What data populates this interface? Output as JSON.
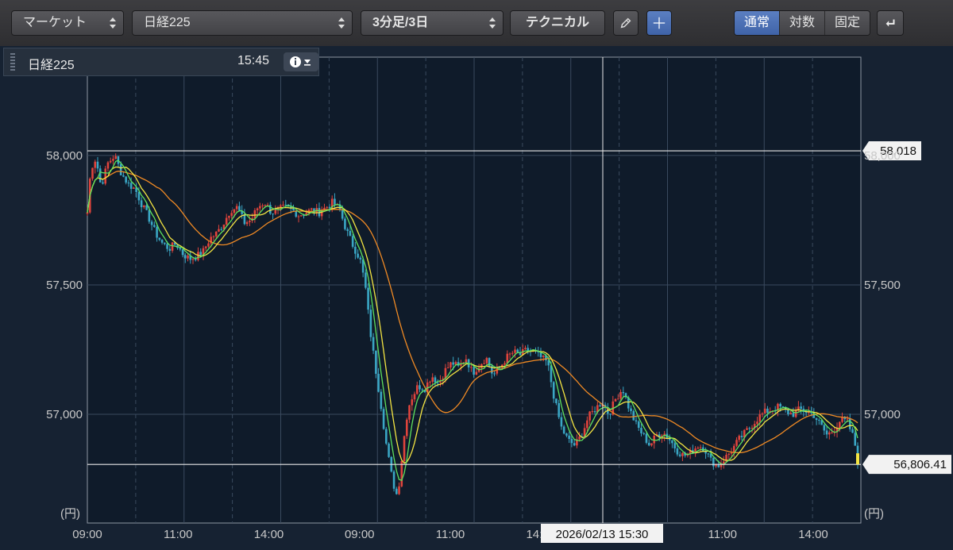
{
  "toolbar": {
    "market_label": "マーケット",
    "symbol_label": "日経225",
    "interval_label": "3分足/3日",
    "technical_label": "テクニカル",
    "scale_modes": [
      {
        "label": "通常",
        "active": true
      },
      {
        "label": "対数",
        "active": false
      },
      {
        "label": "固定",
        "active": false
      }
    ]
  },
  "legend": {
    "symbol": "日経225",
    "time": "15:45"
  },
  "cursor_label": "2026/02/13 15:30",
  "chart_data": {
    "type": "candlestick",
    "y_unit": "(円)",
    "ylim": [
      56580,
      58380
    ],
    "y_ticks": [
      57000,
      57500,
      58000
    ],
    "y_tick_labels": [
      "57,000",
      "57,500",
      "58,000"
    ],
    "x_tick_labels": [
      "09:00",
      "11:00",
      "14:00",
      "09:00",
      "11:00",
      "14:00",
      "09:00",
      "11:00",
      "14:00"
    ],
    "reference_lines": [
      {
        "value": 58018,
        "label": "58,018"
      },
      {
        "value": 56806.41,
        "label": "56,806.41"
      }
    ],
    "colors": {
      "up": "#e0443c",
      "down": "#3aa6c4",
      "ma_short": "#5ee05e",
      "ma_mid": "#f4e542",
      "ma_long": "#f08a24",
      "last": "#f4e542"
    },
    "close_path": [
      [
        0,
        57780
      ],
      [
        0.4,
        57950
      ],
      [
        1.0,
        57990
      ],
      [
        1.6,
        57880
      ],
      [
        2.4,
        57970
      ],
      [
        3.2,
        58000
      ],
      [
        4.0,
        57930
      ],
      [
        4.8,
        57890
      ],
      [
        5.6,
        57870
      ],
      [
        6.4,
        57810
      ],
      [
        7.2,
        57760
      ],
      [
        8.0,
        57700
      ],
      [
        8.8,
        57660
      ],
      [
        9.6,
        57640
      ],
      [
        10.4,
        57660
      ],
      [
        11.2,
        57620
      ],
      [
        12.0,
        57600
      ],
      [
        12.8,
        57610
      ],
      [
        13.6,
        57630
      ],
      [
        14.4,
        57680
      ],
      [
        15.2,
        57700
      ],
      [
        16.0,
        57740
      ],
      [
        16.8,
        57790
      ],
      [
        17.6,
        57800
      ],
      [
        18.4,
        57740
      ],
      [
        19.2,
        57750
      ],
      [
        20.0,
        57800
      ],
      [
        20.8,
        57820
      ],
      [
        21.6,
        57780
      ],
      [
        22.4,
        57790
      ],
      [
        23.2,
        57800
      ],
      [
        24.0,
        57790
      ],
      [
        24.8,
        57770
      ],
      [
        25.6,
        57780
      ],
      [
        26.4,
        57790
      ],
      [
        27.2,
        57780
      ],
      [
        28.0,
        57800
      ],
      [
        28.8,
        57820
      ],
      [
        29.6,
        57790
      ],
      [
        30.4,
        57710
      ],
      [
        31.2,
        57650
      ],
      [
        32.0,
        57600
      ],
      [
        32.6,
        57500
      ],
      [
        33.2,
        57320
      ],
      [
        33.8,
        57180
      ],
      [
        34.4,
        57050
      ],
      [
        35.0,
        56900
      ],
      [
        35.6,
        56780
      ],
      [
        36.0,
        56720
      ],
      [
        36.4,
        56680
      ],
      [
        36.8,
        56800
      ],
      [
        37.2,
        56920
      ],
      [
        37.6,
        57020
      ],
      [
        38.0,
        57060
      ],
      [
        38.8,
        57110
      ],
      [
        39.6,
        57100
      ],
      [
        40.4,
        57150
      ],
      [
        41.2,
        57120
      ],
      [
        42.0,
        57170
      ],
      [
        42.8,
        57200
      ],
      [
        43.6,
        57180
      ],
      [
        44.4,
        57220
      ],
      [
        45.2,
        57160
      ],
      [
        46.0,
        57190
      ],
      [
        46.8,
        57220
      ],
      [
        47.6,
        57150
      ],
      [
        48.4,
        57180
      ],
      [
        49.2,
        57220
      ],
      [
        50.0,
        57240
      ],
      [
        50.8,
        57230
      ],
      [
        51.6,
        57250
      ],
      [
        52.4,
        57240
      ],
      [
        53.2,
        57220
      ],
      [
        54.0,
        57200
      ],
      [
        54.8,
        57060
      ],
      [
        55.6,
        56950
      ],
      [
        56.4,
        56900
      ],
      [
        57.2,
        56880
      ],
      [
        58.0,
        56920
      ],
      [
        58.8,
        56990
      ],
      [
        59.6,
        57020
      ],
      [
        60.4,
        57050
      ],
      [
        61.2,
        57000
      ],
      [
        62.0,
        57060
      ],
      [
        62.8,
        57100
      ],
      [
        63.6,
        57020
      ],
      [
        64.4,
        56960
      ],
      [
        65.2,
        56920
      ],
      [
        66.0,
        56880
      ],
      [
        66.8,
        56920
      ],
      [
        67.6,
        56930
      ],
      [
        68.4,
        56900
      ],
      [
        69.2,
        56860
      ],
      [
        70.0,
        56840
      ],
      [
        70.8,
        56850
      ],
      [
        71.6,
        56880
      ],
      [
        72.4,
        56870
      ],
      [
        73.2,
        56820
      ],
      [
        74.0,
        56800
      ],
      [
        74.8,
        56830
      ],
      [
        75.6,
        56860
      ],
      [
        76.4,
        56900
      ],
      [
        77.2,
        56930
      ],
      [
        78.0,
        56960
      ],
      [
        78.8,
        56990
      ],
      [
        79.6,
        57010
      ],
      [
        80.4,
        57020
      ],
      [
        81.2,
        57030
      ],
      [
        82.0,
        57010
      ],
      [
        82.8,
        57000
      ],
      [
        83.6,
        57020
      ],
      [
        84.4,
        57010
      ],
      [
        85.2,
        57000
      ],
      [
        86.0,
        56960
      ],
      [
        86.8,
        56920
      ],
      [
        87.6,
        56940
      ],
      [
        88.4,
        56980
      ],
      [
        89.2,
        56970
      ],
      [
        90.0,
        56900
      ],
      [
        90.4,
        56820
      ]
    ]
  }
}
